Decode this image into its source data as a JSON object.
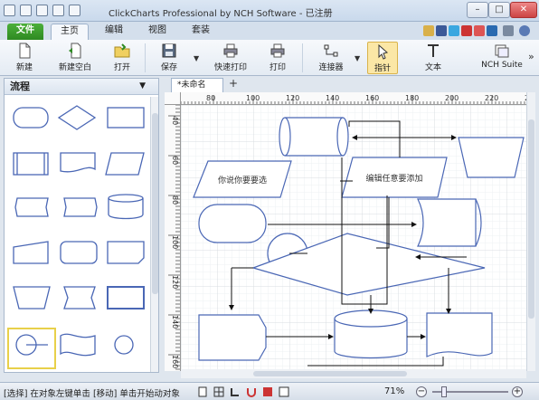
{
  "window": {
    "title": "ClickCharts Professional by NCH Software - 已注册",
    "min": "–",
    "max": "□",
    "close": "✕"
  },
  "ribbon_tabs": [
    {
      "label": "文件"
    },
    {
      "label": "主页"
    },
    {
      "label": "编辑"
    },
    {
      "label": "视图"
    },
    {
      "label": "套装"
    }
  ],
  "toolbar": {
    "new": "新建",
    "new_blank": "新建空白",
    "open": "打开",
    "save": "保存",
    "quick_print": "快速打印",
    "print": "打印",
    "connector": "连接器",
    "pointer": "指针",
    "text": "文本",
    "nch_suite": "NCH Suite",
    "more": "»"
  },
  "left_panel": {
    "title": "流程",
    "dropdown": "▼"
  },
  "document": {
    "tab_label": "*未命名",
    "add": "+"
  },
  "ruler": {
    "h_ticks": [
      "80",
      "100",
      "120",
      "140",
      "160",
      "180",
      "200",
      "220",
      "24"
    ],
    "v_ticks": [
      "40",
      "60",
      "80",
      "100",
      "120",
      "140",
      "160"
    ]
  },
  "diagram": {
    "io_left": "你说你要要选",
    "io_right": "编辑任意要添加"
  },
  "statusbar": {
    "text": "[选择] 在对象左键单击 [移动] 单击开始动对象",
    "zoom": "71%",
    "zoom_out": "−",
    "zoom_in": "+"
  },
  "colors": {
    "accent": "#2e8a22",
    "shape_stroke": "#4a67b5",
    "selection": "#e8d04a"
  }
}
